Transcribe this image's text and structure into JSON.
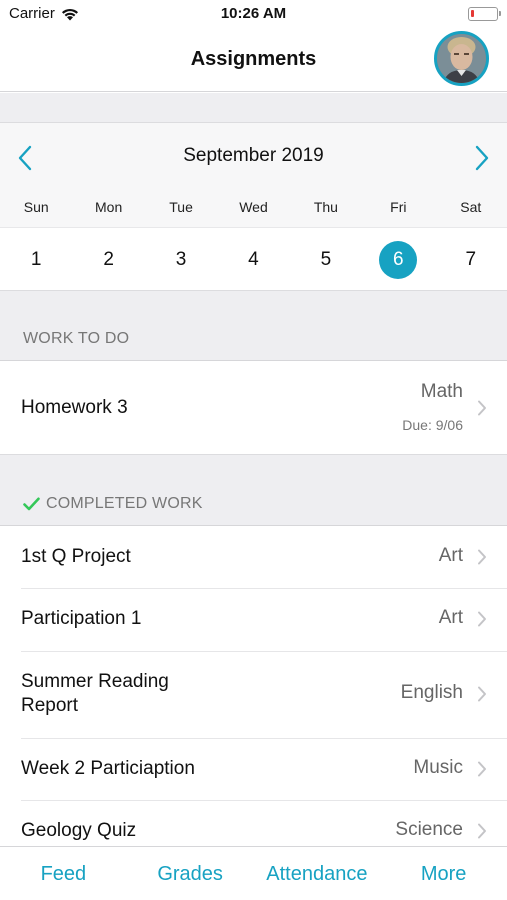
{
  "status_bar": {
    "carrier": "Carrier",
    "time": "10:26 AM",
    "battery_level": 0.1,
    "battery_color": "#e53935"
  },
  "header": {
    "title": "Assignments",
    "avatar_icon": "student-photo-avatar"
  },
  "calendar": {
    "month": "September 2019",
    "prev_icon": "chevron-left-icon",
    "next_icon": "chevron-right-icon",
    "weekdays": [
      "Sun",
      "Mon",
      "Tue",
      "Wed",
      "Thu",
      "Fri",
      "Sat"
    ],
    "dates": [
      "1",
      "2",
      "3",
      "4",
      "5",
      "6",
      "7"
    ],
    "selected_date": "6",
    "accent": "#17a2c2"
  },
  "work_to_do": {
    "heading": "WORK TO DO",
    "items": [
      {
        "title": "Homework 3",
        "subject": "Math",
        "due": "Due: 9/06"
      }
    ]
  },
  "completed_work": {
    "heading": "COMPLETED WORK",
    "icon": "check-icon",
    "check_color": "#34c759",
    "items": [
      {
        "title": "1st Q Project",
        "subject": "Art"
      },
      {
        "title": "Participation 1",
        "subject": "Art"
      },
      {
        "title": "Summer Reading",
        "title_line2": "Report",
        "subject": "English"
      },
      {
        "title": "Week 2 Particiaption",
        "subject": "Music"
      },
      {
        "title": "Geology Quiz",
        "subject": "Science"
      }
    ]
  },
  "tab_bar": {
    "tabs": [
      "Feed",
      "Grades",
      "Attendance",
      "More"
    ]
  }
}
